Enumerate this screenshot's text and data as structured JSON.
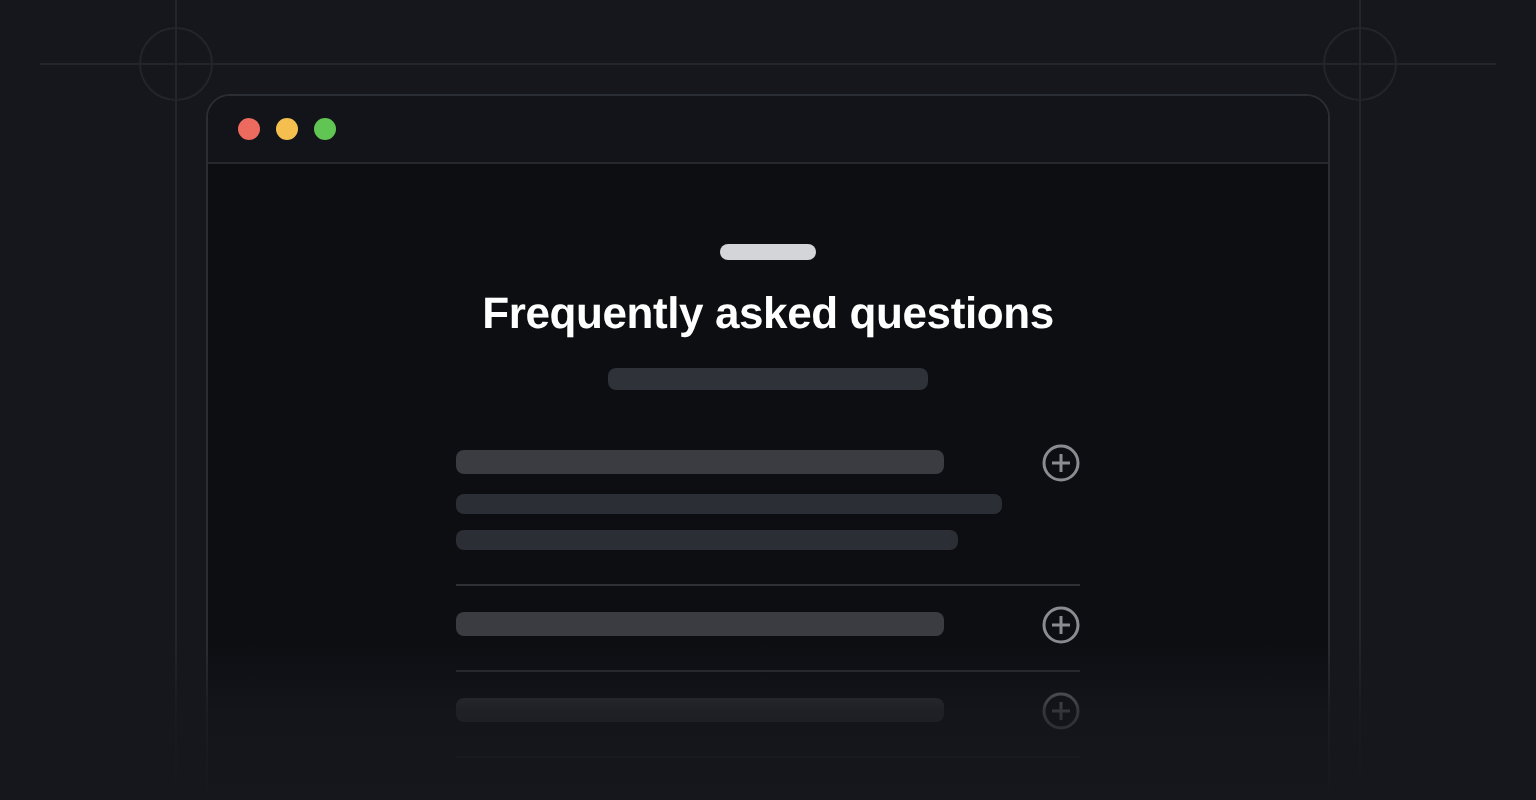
{
  "heading": "Frequently asked questions",
  "faqs": [
    {
      "expanded": true
    },
    {
      "expanded": false
    },
    {
      "expanded": false
    }
  ]
}
